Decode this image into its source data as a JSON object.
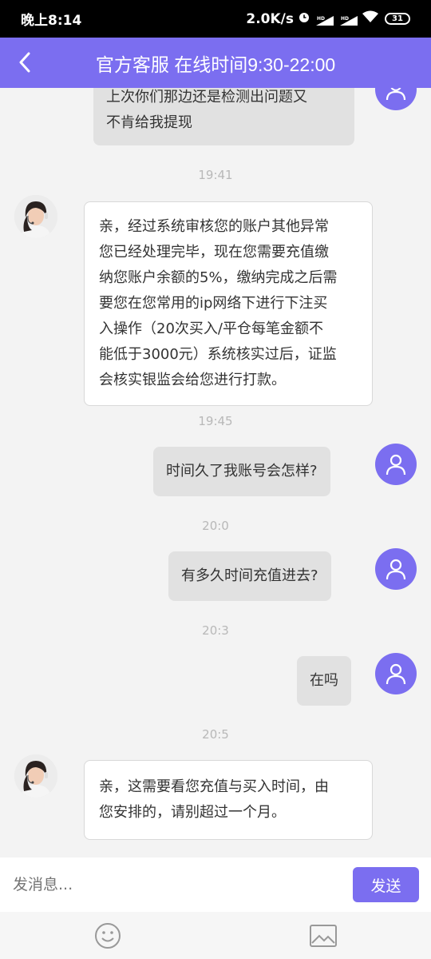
{
  "status_bar": {
    "time": "晚上8:14",
    "speed": "2.0K/s",
    "hd1": "HD",
    "hd2": "HD",
    "battery": "31"
  },
  "header": {
    "title": "官方客服 在线时间9:30-22:00"
  },
  "messages": [
    {
      "sender": "me",
      "text": "上次你们那边还是检测出问题又不肯给我提现",
      "lines": [
        "上次你们那边还是检测出问题又",
        "不肯给我提现"
      ]
    },
    {
      "timestamp": "19:41"
    },
    {
      "sender": "agent",
      "lines": [
        "亲，经过系统审核您的账户其他异常",
        "您已经处理完毕，现在您需要充值缴",
        "纳您账户余额的5%，缴纳完成之后需",
        "要您在您常用的ip网络下进行下注买",
        "入操作（20次买入/平仓每笔金额不",
        "能低于3000元）系统核实过后，证监",
        "会核实银监会给您进行打款。"
      ]
    },
    {
      "timestamp": "19:45"
    },
    {
      "sender": "me",
      "text": "时间久了我账号会怎样?"
    },
    {
      "timestamp": "20:0"
    },
    {
      "sender": "me",
      "text": "有多久时间充值进去?"
    },
    {
      "timestamp": "20:3"
    },
    {
      "sender": "me",
      "text": "在吗"
    },
    {
      "timestamp": "20:5"
    },
    {
      "sender": "agent",
      "lines": [
        "亲，这需要看您充值与买入时间，由",
        "您安排的，请别超过一个月。"
      ]
    }
  ],
  "input": {
    "placeholder": "发消息...",
    "send_label": "发送"
  },
  "toolbar": {
    "icons": [
      "emoji-icon",
      "image-icon"
    ]
  },
  "colors": {
    "accent": "#7b6ef0",
    "bubble_me": "#e1e1e1",
    "bubble_agent": "#ffffff",
    "background": "#f3f3f3"
  }
}
